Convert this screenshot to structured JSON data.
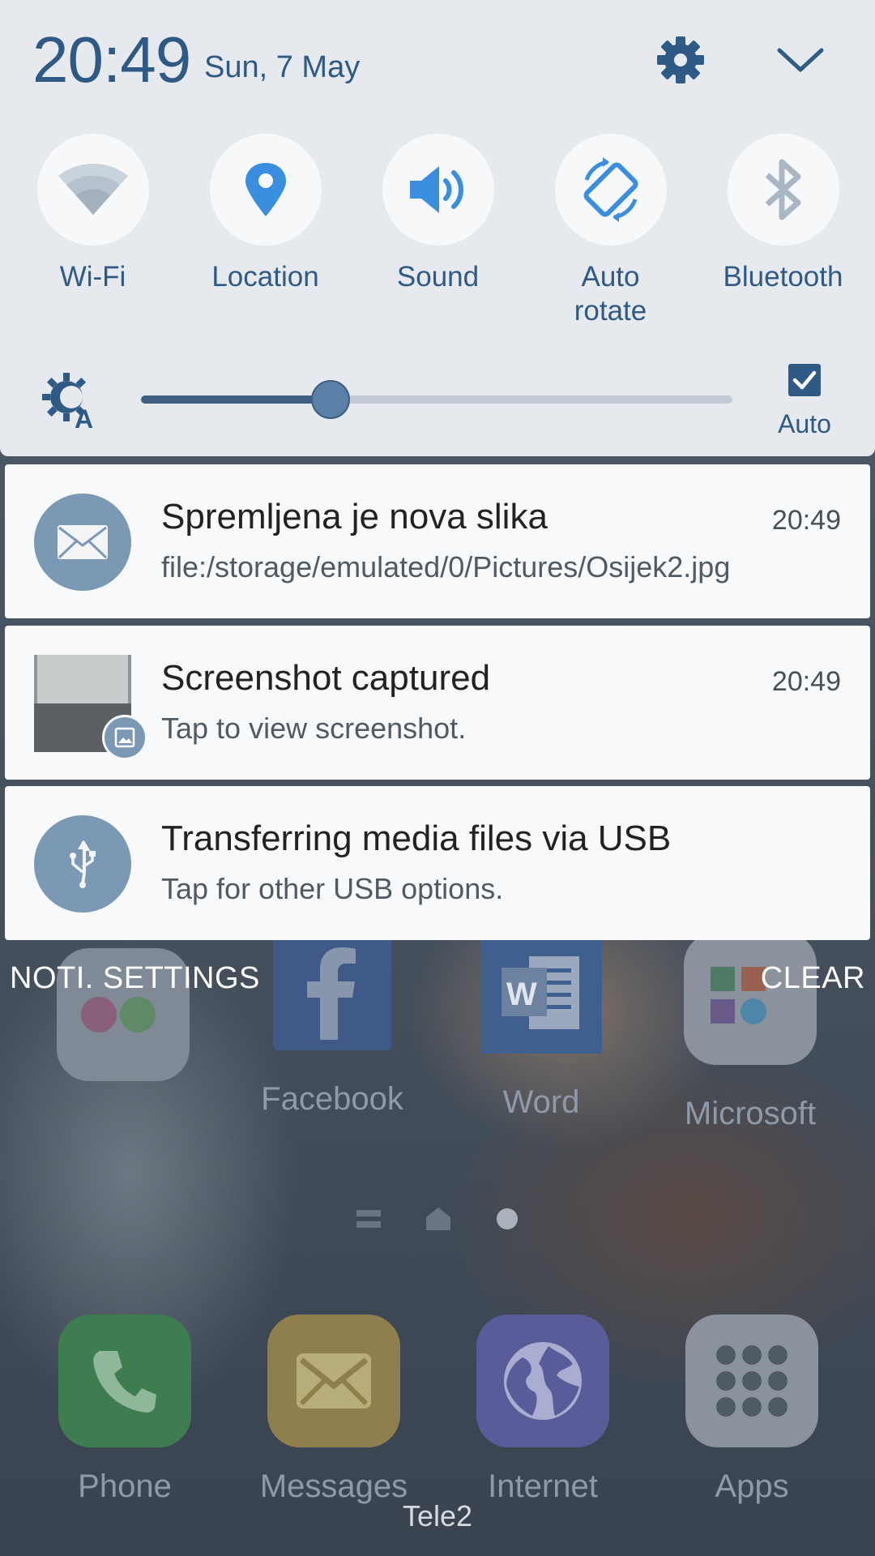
{
  "status": {
    "time": "20:49",
    "date": "Sun, 7 May"
  },
  "quick_panel": {
    "toggles": [
      {
        "label": "Wi-Fi",
        "icon": "wifi-icon",
        "active": false
      },
      {
        "label": "Location",
        "icon": "location-pin-icon",
        "active": true
      },
      {
        "label": "Sound",
        "icon": "sound-icon",
        "active": true
      },
      {
        "label": "Auto\nrotate",
        "label_line1": "Auto",
        "label_line2": "rotate",
        "icon": "auto-rotate-icon",
        "active": true
      },
      {
        "label": "Bluetooth",
        "icon": "bluetooth-icon",
        "active": false
      }
    ],
    "brightness": {
      "level": 0.32,
      "auto_label": "Auto",
      "auto_checked": true
    }
  },
  "notifications": [
    {
      "icon": "email-icon",
      "title": "Spremljena je nova slika",
      "time": "20:49",
      "body": "file:/storage/emulated/0/Pictures/Osijek2.jpg"
    },
    {
      "icon": "screenshot-thumbnail",
      "title": "Screenshot captured",
      "time": "20:49",
      "body": "Tap to view screenshot."
    },
    {
      "icon": "usb-icon",
      "title": "Transferring media files via USB",
      "time": "",
      "body": "Tap for other USB options."
    }
  ],
  "panel_actions": {
    "settings_label": "NOTI. SETTINGS",
    "clear_label": "CLEAR"
  },
  "home": {
    "apps_row": [
      {
        "label": "Facebook"
      },
      {
        "label": "Word"
      },
      {
        "label": "Microsoft"
      }
    ],
    "dock": [
      {
        "label": "Phone"
      },
      {
        "label": "Messages"
      },
      {
        "label": "Internet"
      },
      {
        "label": "Apps"
      }
    ],
    "carrier": "Tele2"
  },
  "colors": {
    "accent": "#2e5a85",
    "panel_bg": "#e6eaef",
    "notification_bg": "#f8f9fa",
    "icon_circle": "#7b98b5"
  }
}
